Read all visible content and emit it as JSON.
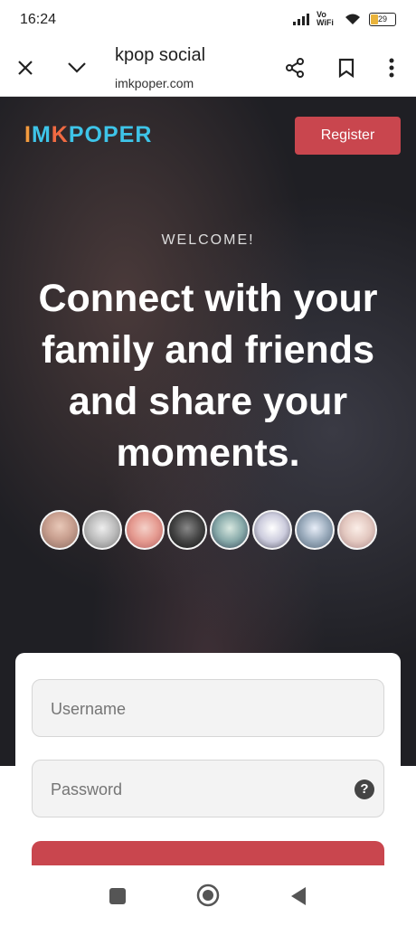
{
  "status_bar": {
    "time": "16:24",
    "network": "Vo WiFi",
    "battery": "29"
  },
  "browser": {
    "title": "kpop social",
    "url": "imkpoper.com"
  },
  "header": {
    "logo": [
      "I",
      "M",
      "K",
      "POPER"
    ],
    "register_label": "Register"
  },
  "hero": {
    "kicker": "WELCOME!",
    "headline": "Connect with your family and friends and share your moments.",
    "avatar_count": 8
  },
  "form": {
    "username_placeholder": "Username",
    "password_placeholder": "Password",
    "help_icon": "?"
  },
  "colors": {
    "accent": "#c9464e",
    "logo_orange": "#f39b3e",
    "logo_blue": "#3ec4e8",
    "logo_red": "#f06a42"
  }
}
